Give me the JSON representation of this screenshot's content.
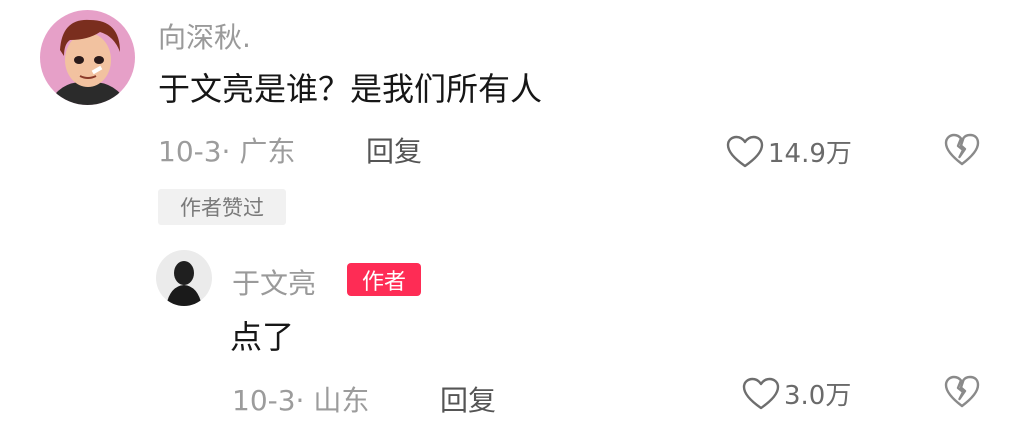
{
  "comment": {
    "username": "向深秋.",
    "text": "于文亮是谁？是我们所有人",
    "meta": "10-3· 广东",
    "reply_label": "回复",
    "like_count": "14.9万",
    "badge": "作者赞过",
    "avatar_icon": "cartoon-avatar",
    "like_icon": "heart-outline",
    "dislike_icon": "broken-heart"
  },
  "reply": {
    "username": "于文亮",
    "author_tag": "作者",
    "text": "点了",
    "meta": "10-3· 山东",
    "reply_label": "回复",
    "like_count": "3.0万",
    "avatar_icon": "silhouette-avatar",
    "like_icon": "heart-outline",
    "dislike_icon": "broken-heart"
  },
  "colors": {
    "author_tag_bg": "#fe2c55",
    "muted_text": "#9c9c9c",
    "body_text": "#161616",
    "badge_bg": "#f1f1f1"
  }
}
